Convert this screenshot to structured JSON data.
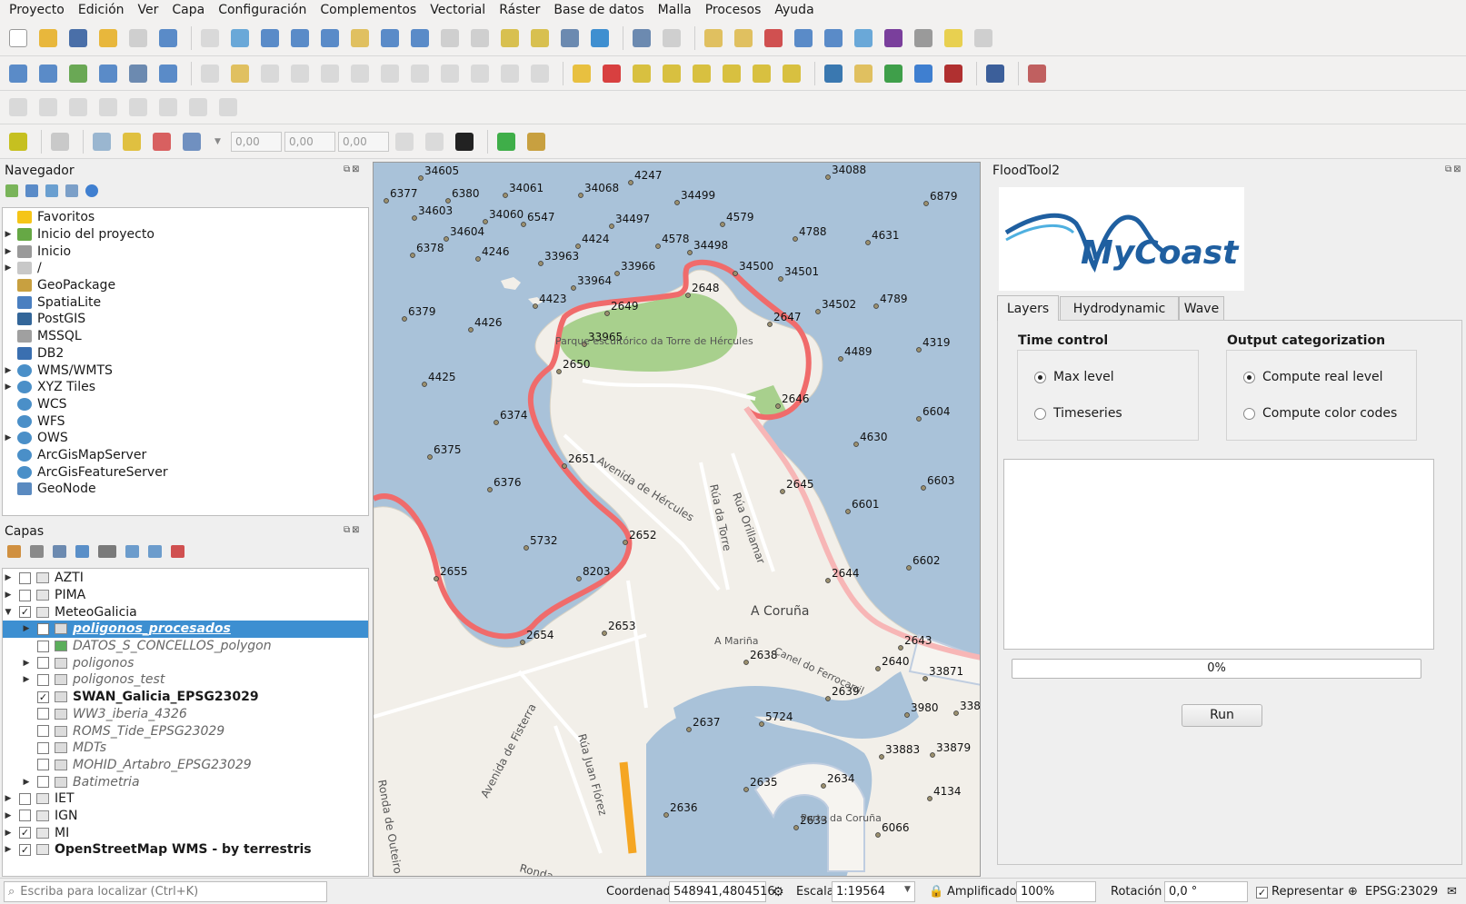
{
  "menu": [
    "Proyecto",
    "Edición",
    "Ver",
    "Capa",
    "Configuración",
    "Complementos",
    "Vectorial",
    "Ráster",
    "Base de datos",
    "Malla",
    "Procesos",
    "Ayuda"
  ],
  "toolbar4": {
    "x_value": "0,00",
    "y_value": "0,00",
    "z_value": "0,00"
  },
  "navigator": {
    "title": "Navegador",
    "items": [
      {
        "label": "Favoritos",
        "icon": "star-icon",
        "expandable": false
      },
      {
        "label": "Inicio del proyecto",
        "icon": "project-home-icon",
        "expandable": true
      },
      {
        "label": "Inicio",
        "icon": "home-folder-icon",
        "expandable": true
      },
      {
        "label": "/",
        "icon": "folder-icon",
        "expandable": true
      },
      {
        "label": "GeoPackage",
        "icon": "geopackage-icon",
        "expandable": false
      },
      {
        "label": "SpatiaLite",
        "icon": "spatialite-icon",
        "expandable": false
      },
      {
        "label": "PostGIS",
        "icon": "postgis-icon",
        "expandable": false
      },
      {
        "label": "MSSQL",
        "icon": "mssql-icon",
        "expandable": false
      },
      {
        "label": "DB2",
        "icon": "db2-icon",
        "expandable": false
      },
      {
        "label": "WMS/WMTS",
        "icon": "globe-icon",
        "expandable": true
      },
      {
        "label": "XYZ Tiles",
        "icon": "globe-icon",
        "expandable": true
      },
      {
        "label": "WCS",
        "icon": "globe-icon",
        "expandable": false
      },
      {
        "label": "WFS",
        "icon": "globe-icon",
        "expandable": false
      },
      {
        "label": "OWS",
        "icon": "globe-icon",
        "expandable": true
      },
      {
        "label": "ArcGisMapServer",
        "icon": "globe-icon",
        "expandable": false
      },
      {
        "label": "ArcGisFeatureServer",
        "icon": "globe-icon",
        "expandable": false
      },
      {
        "label": "GeoNode",
        "icon": "geonode-icon",
        "expandable": false
      }
    ]
  },
  "layers": {
    "title": "Capas",
    "items": [
      {
        "label": "AZTI",
        "indent": 0,
        "checked": false,
        "expander": "closed",
        "style": "normal"
      },
      {
        "label": "PIMA",
        "indent": 0,
        "checked": false,
        "expander": "closed",
        "style": "normal"
      },
      {
        "label": "MeteoGalicia",
        "indent": 0,
        "checked": true,
        "expander": "open",
        "style": "normal"
      },
      {
        "label": "poligonos_procesados",
        "indent": 1,
        "checked": true,
        "expander": "closed",
        "style": "selected"
      },
      {
        "label": "DATOS_S_CONCELLOS_polygon",
        "indent": 1,
        "checked": false,
        "expander": "none",
        "style": "italic"
      },
      {
        "label": "poligonos",
        "indent": 1,
        "checked": false,
        "expander": "closed",
        "style": "italic"
      },
      {
        "label": "poligonos_test",
        "indent": 1,
        "checked": false,
        "expander": "closed",
        "style": "italic"
      },
      {
        "label": "SWAN_Galicia_EPSG23029",
        "indent": 1,
        "checked": true,
        "expander": "none",
        "style": "bold"
      },
      {
        "label": "WW3_iberia_4326",
        "indent": 1,
        "checked": false,
        "expander": "none",
        "style": "italic"
      },
      {
        "label": "ROMS_Tide_EPSG23029",
        "indent": 1,
        "checked": false,
        "expander": "none",
        "style": "italic"
      },
      {
        "label": "MDTs",
        "indent": 1,
        "checked": false,
        "expander": "none",
        "style": "italic"
      },
      {
        "label": "MOHID_Artabro_EPSG23029",
        "indent": 1,
        "checked": false,
        "expander": "none",
        "style": "italic"
      },
      {
        "label": "Batimetria",
        "indent": 1,
        "checked": false,
        "expander": "closed",
        "style": "italic"
      },
      {
        "label": "IET",
        "indent": 0,
        "checked": false,
        "expander": "closed",
        "style": "normal"
      },
      {
        "label": "IGN",
        "indent": 0,
        "checked": false,
        "expander": "closed",
        "style": "normal"
      },
      {
        "label": "MI",
        "indent": 0,
        "checked": true,
        "expander": "closed",
        "style": "normal"
      },
      {
        "label": "OpenStreetMap WMS - by terrestris",
        "indent": 0,
        "checked": true,
        "expander": "closed",
        "style": "bold"
      }
    ]
  },
  "map": {
    "labels": {
      "park": "Parque escultórico da Torre de Hércules",
      "city": "A Coruña",
      "marina": "A Mariña",
      "port": "Porto da Coruña",
      "street1": "Avenida de Hércules",
      "street2": "Rúa da Torre",
      "street3": "Rúa Orillamar",
      "street4": "Avenida de Fisterra",
      "street5": "Rúa Juan Flórez",
      "street6": "Ronda de Outeiro",
      "street7": "Ronda",
      "street8": "Canel do Ferrocarril"
    },
    "points": [
      {
        "id": "34605",
        "pos": "upper-left"
      },
      {
        "id": "34061"
      },
      {
        "id": "34068"
      },
      {
        "id": "4247"
      },
      {
        "id": "34088"
      },
      {
        "id": "6377"
      },
      {
        "id": "6380"
      },
      {
        "id": "34499"
      },
      {
        "id": "6879"
      },
      {
        "id": "34603"
      },
      {
        "id": "34060"
      },
      {
        "id": "6547"
      },
      {
        "id": "34497"
      },
      {
        "id": "4579"
      },
      {
        "id": "34604"
      },
      {
        "id": "4788"
      },
      {
        "id": "4631"
      },
      {
        "id": "6378"
      },
      {
        "id": "4246"
      },
      {
        "id": "4424"
      },
      {
        "id": "4578"
      },
      {
        "id": "34498"
      },
      {
        "id": "33963"
      },
      {
        "id": "33966"
      },
      {
        "id": "34500"
      },
      {
        "id": "34501"
      },
      {
        "id": "33964"
      },
      {
        "id": "2648"
      },
      {
        "id": "4423"
      },
      {
        "id": "2649"
      },
      {
        "id": "34502"
      },
      {
        "id": "4789"
      },
      {
        "id": "6379"
      },
      {
        "id": "4426"
      },
      {
        "id": "2647"
      },
      {
        "id": "33965"
      },
      {
        "id": "4319"
      },
      {
        "id": "4489"
      },
      {
        "id": "2650"
      },
      {
        "id": "4425"
      },
      {
        "id": "2646"
      },
      {
        "id": "6604"
      },
      {
        "id": "6374"
      },
      {
        "id": "4630"
      },
      {
        "id": "6375"
      },
      {
        "id": "2651"
      },
      {
        "id": "6603"
      },
      {
        "id": "6376"
      },
      {
        "id": "2645"
      },
      {
        "id": "6601"
      },
      {
        "id": "2652"
      },
      {
        "id": "5732"
      },
      {
        "id": "6602"
      },
      {
        "id": "2655"
      },
      {
        "id": "8203"
      },
      {
        "id": "2644"
      },
      {
        "id": "2653"
      },
      {
        "id": "2654"
      },
      {
        "id": "2643"
      },
      {
        "id": "2638"
      },
      {
        "id": "2640"
      },
      {
        "id": "33871"
      },
      {
        "id": "2639"
      },
      {
        "id": "3980"
      },
      {
        "id": "338"
      },
      {
        "id": "5724"
      },
      {
        "id": "2637"
      },
      {
        "id": "33883"
      },
      {
        "id": "33879"
      },
      {
        "id": "2635"
      },
      {
        "id": "2634"
      },
      {
        "id": "4134"
      },
      {
        "id": "2636"
      },
      {
        "id": "2633"
      },
      {
        "id": "6066"
      }
    ]
  },
  "plugin": {
    "title": "FloodTool2",
    "logo_text": "MyCoast",
    "tabs": [
      "Layers",
      "Hydrodynamic",
      "Wave"
    ],
    "time_control": {
      "title": "Time control",
      "options": [
        "Max level",
        "Timeseries"
      ],
      "selected": 0
    },
    "output_cat": {
      "title": "Output categorization",
      "options": [
        "Compute real level",
        "Compute color codes"
      ],
      "selected": 0
    },
    "progress": "0%",
    "progress_value": 0,
    "run_label": "Run"
  },
  "status": {
    "search_placeholder": "Escriba para localizar (Ctrl+K)",
    "coord_label": "Coordenada",
    "coord_value": "548941,4804516",
    "scale_label": "Escala",
    "scale_value": "1:19564",
    "magnifier_label": "Amplificador",
    "magnifier_value": "100%",
    "rotation_label": "Rotación",
    "rotation_value": "0,0 °",
    "render_label": "Representar",
    "crs": "EPSG:23029"
  },
  "colors": {
    "selection": "#3d8fd1",
    "sea": "#aac3da",
    "land": "#f2efe9",
    "park": "#a8d08d",
    "flood_dark": "#f06b6b",
    "flood_light": "#f7b6b6"
  }
}
